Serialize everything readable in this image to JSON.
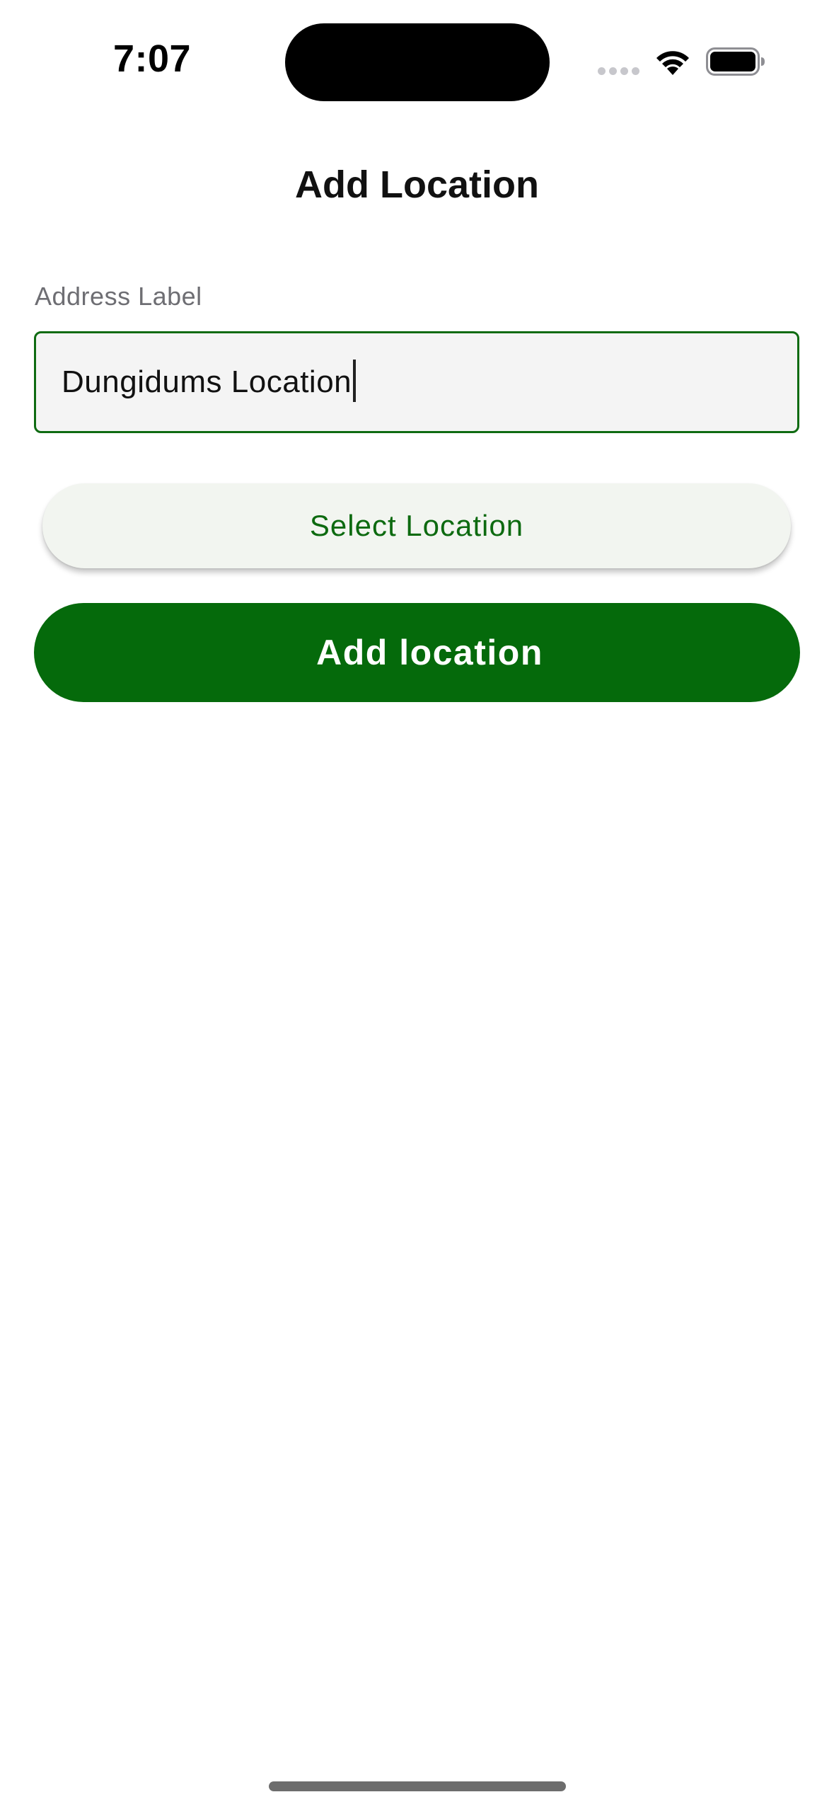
{
  "status_bar": {
    "time": "7:07",
    "icons": [
      "signal-dots-icon",
      "wifi-icon",
      "battery-icon"
    ]
  },
  "header": {
    "title": "Add Location"
  },
  "form": {
    "address_label": "Address Label",
    "address_value": "Dungidums Location"
  },
  "buttons": {
    "select_location": "Select Location",
    "add_location": "Add location"
  },
  "colors": {
    "accent": "#056a0b",
    "input_border": "#0f6b12",
    "select_button_bg": "#f2f5f0",
    "select_button_text": "#0d6a10",
    "input_bg": "#f4f4f4"
  }
}
